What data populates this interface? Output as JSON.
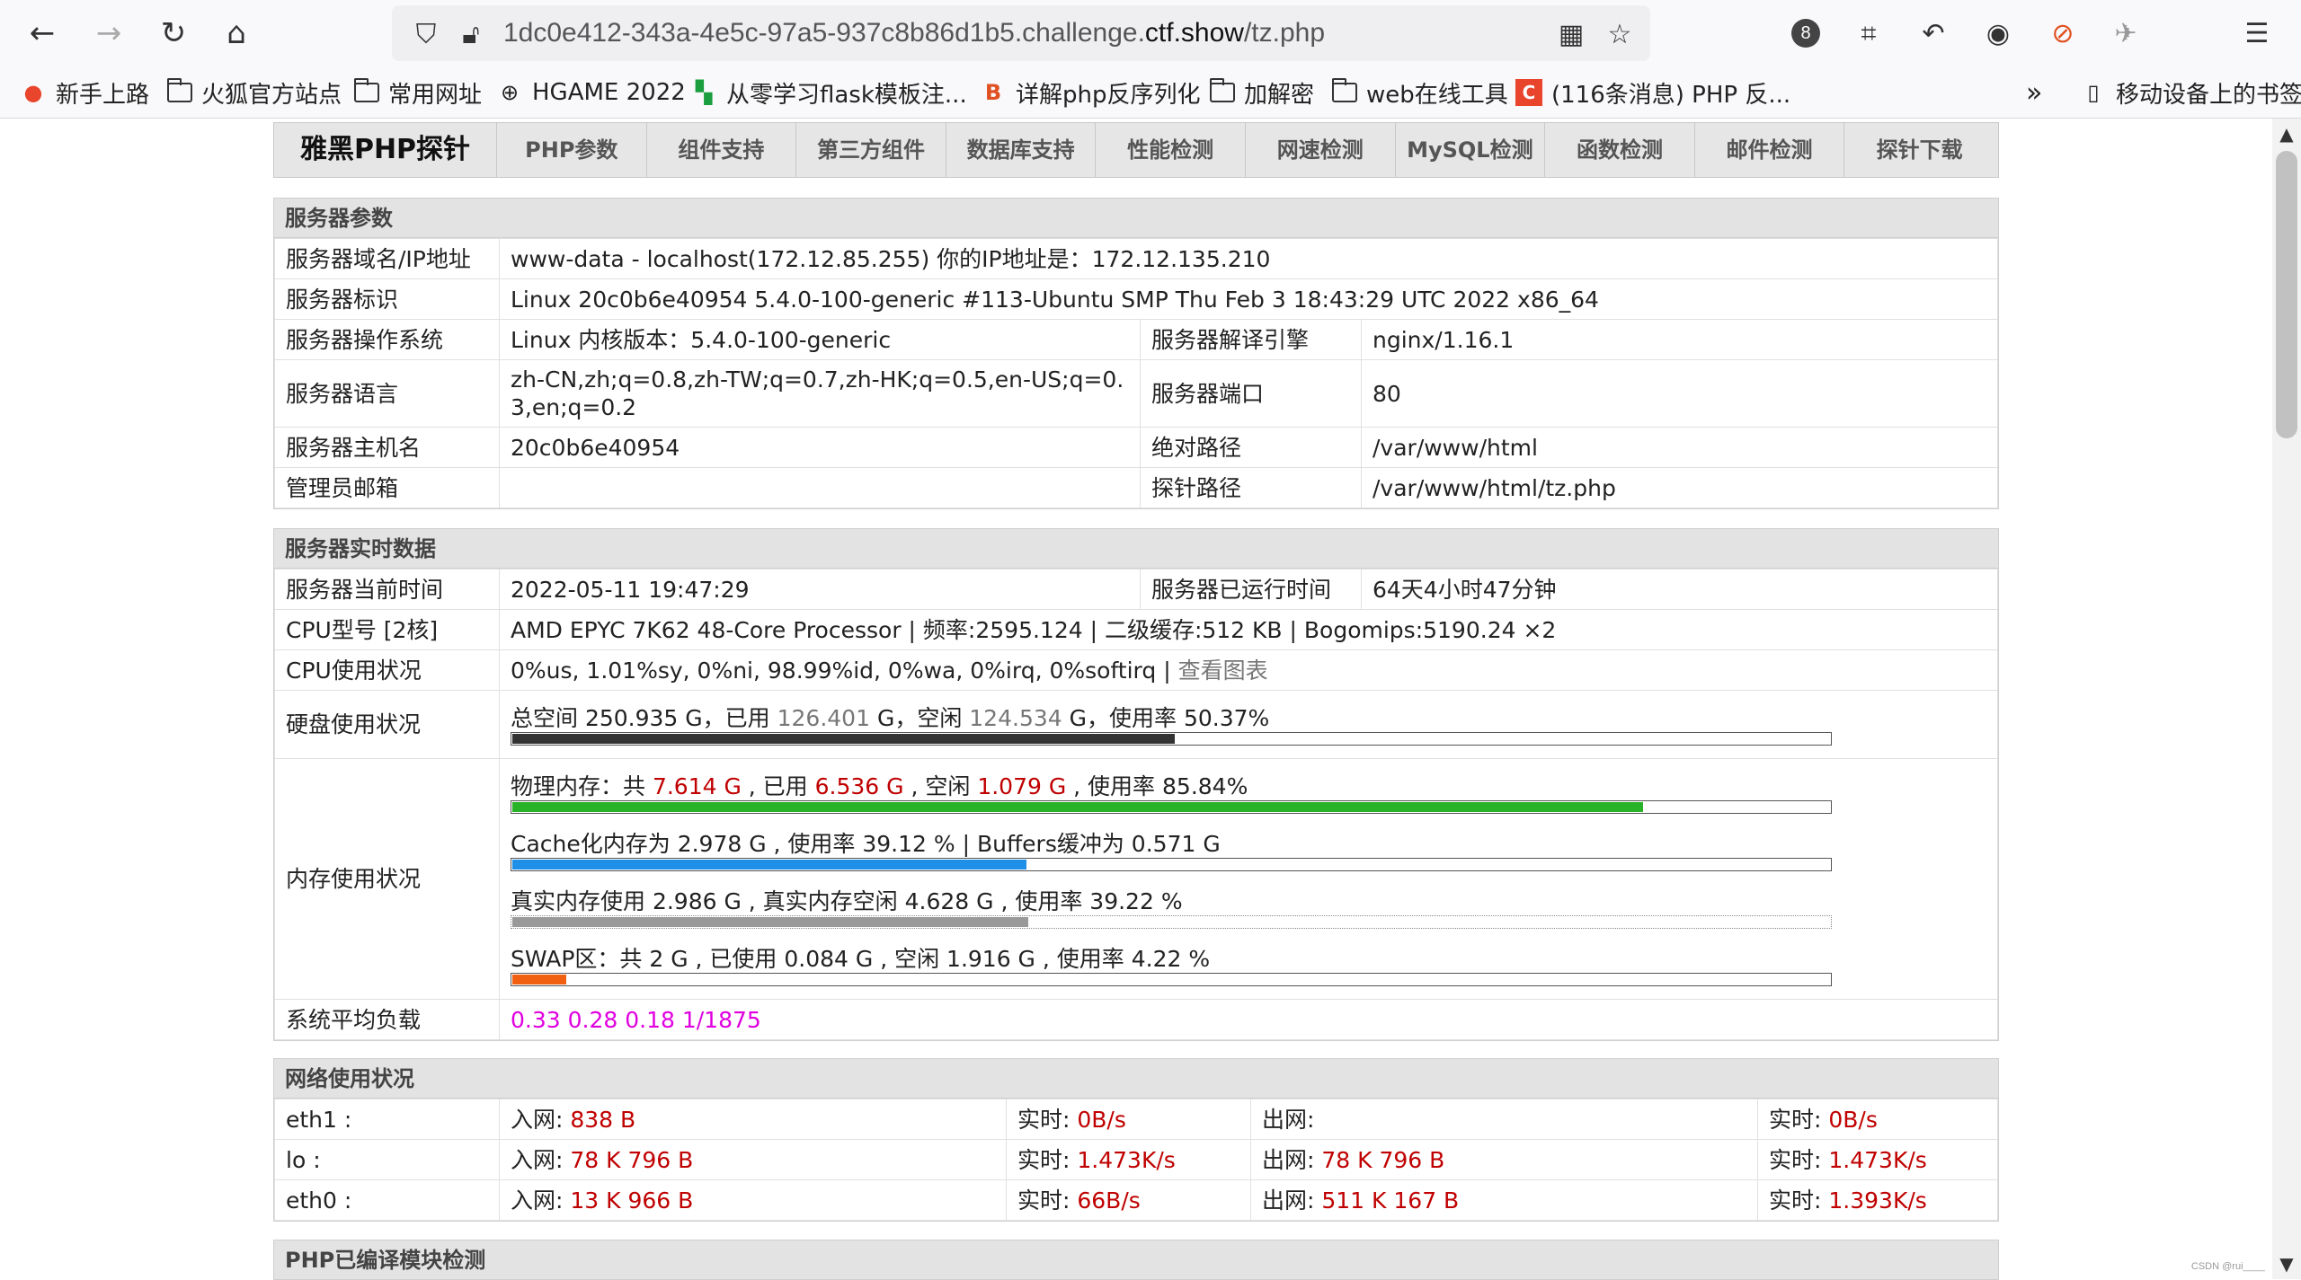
{
  "browser": {
    "url_prefix": "1dc0e412-343a-4e5c-97a5-937c8b86d1b5.challenge.",
    "url_host": "ctf.show",
    "url_path": "/tz.php",
    "extension_badge": "8",
    "bookmarks": [
      {
        "label": "新手上路",
        "icon": "firefox-icon"
      },
      {
        "label": "火狐官方站点",
        "icon": "folder-icon"
      },
      {
        "label": "常用网址",
        "icon": "folder-icon"
      },
      {
        "label": "HGAME 2022",
        "icon": "globe-icon"
      },
      {
        "label": "从零学习flask模板注...",
        "icon": "site-icon"
      },
      {
        "label": "详解php反序列化",
        "icon": "site-icon"
      },
      {
        "label": "加解密",
        "icon": "folder-icon"
      },
      {
        "label": "web在线工具",
        "icon": "folder-icon"
      },
      {
        "label": "(116条消息) PHP 反...",
        "icon": "csdn-icon"
      }
    ],
    "mobile_bookmarks": "移动设备上的书签",
    "overflow": "»"
  },
  "nav": {
    "brand": "雅黑PHP探针",
    "items": [
      "PHP参数",
      "组件支持",
      "第三方组件",
      "数据库支持",
      "性能检测",
      "网速检测",
      "MySQL检测",
      "函数检测",
      "邮件检测",
      "探针下载"
    ]
  },
  "server": {
    "title": "服务器参数",
    "domain_label": "服务器域名/IP地址",
    "domain_value": "www-data - localhost(172.12.85.255)  你的IP地址是：172.12.135.210",
    "id_label": "服务器标识",
    "id_value": "Linux 20c0b6e40954 5.4.0-100-generic #113-Ubuntu SMP Thu Feb 3 18:43:29 UTC 2022 x86_64",
    "os_label": "服务器操作系统",
    "os_value": "Linux  内核版本：5.4.0-100-generic",
    "engine_label": "服务器解译引擎",
    "engine_value": "nginx/1.16.1",
    "lang_label": "服务器语言",
    "lang_value": "zh-CN,zh;q=0.8,zh-TW;q=0.7,zh-HK;q=0.5,en-US;q=0.3,en;q=0.2",
    "port_label": "服务器端口",
    "port_value": "80",
    "host_label": "服务器主机名",
    "host_value": "20c0b6e40954",
    "abspath_label": "绝对路径",
    "abspath_value": "/var/www/html",
    "admin_label": "管理员邮箱",
    "admin_value": "",
    "probe_label": "探针路径",
    "probe_value": "/var/www/html/tz.php"
  },
  "realtime": {
    "title": "服务器实时数据",
    "time_label": "服务器当前时间",
    "time_value": "2022-05-11 19:47:29",
    "uptime_label": "服务器已运行时间",
    "uptime_value": "64天4小时47分钟",
    "cpu_label": "CPU型号 [2核]",
    "cpu_value": "AMD EPYC 7K62 48-Core Processor | 频率:2595.124 | 二级缓存:512 KB | Bogomips:5190.24 ×2",
    "cpuuse_label": "CPU使用状况",
    "cpuuse_value": "0%us, 1.01%sy, 0%ni, 98.99%id, 0%wa, 0%irq, 0%softirq | ",
    "cpuuse_link": "查看图表",
    "disk_label": "硬盘使用状况",
    "disk": {
      "t1": "总空间 250.935 G，已用 ",
      "used": "126.401",
      "t2": " G，空闲 ",
      "free": "124.534",
      "t3": " G，使用率 50.37%",
      "percent": 50.37
    },
    "mem_label": "内存使用状况",
    "mem_physical": {
      "t1": "物理内存：共 ",
      "total": "7.614 G",
      "t2": " , 已用 ",
      "used": "6.536 G",
      "t3": " , 空闲 ",
      "free": "1.079 G",
      "t4": " , 使用率 85.84%",
      "percent": 85.84
    },
    "mem_cache": {
      "text": "Cache化内存为 2.978 G , 使用率 39.12 % | Buffers缓冲为 0.571 G",
      "percent": 39.12
    },
    "mem_real": {
      "text": "真实内存使用 2.986 G , 真实内存空闲 4.628 G , 使用率 39.22 %",
      "percent": 39.22
    },
    "mem_swap": {
      "text": "SWAP区：共 2 G , 已使用 0.084 G , 空闲 1.916 G , 使用率 4.22 %",
      "percent": 4.22
    },
    "load_label": "系统平均负载",
    "load_value": "0.33 0.28 0.18 1/1875"
  },
  "network": {
    "title": "网络使用状况",
    "rows": [
      {
        "iface": "eth1 :",
        "in_label": "入网: ",
        "in": "838 B",
        "rt1_label": "实时: ",
        "rt1": "0B/s",
        "out_label": "出网: ",
        "out": "",
        "rt2_label": "实时: ",
        "rt2": "0B/s"
      },
      {
        "iface": "lo :",
        "in_label": "入网: ",
        "in": "78 K 796 B",
        "rt1_label": "实时: ",
        "rt1": "1.473K/s",
        "out_label": "出网: ",
        "out": "78 K 796 B",
        "rt2_label": "实时: ",
        "rt2": "1.473K/s"
      },
      {
        "iface": "eth0 :",
        "in_label": "入网: ",
        "in": "13 K 966 B",
        "rt1_label": "实时: ",
        "rt1": "66B/s",
        "out_label": "出网: ",
        "out": "511 K 167 B",
        "rt2_label": "实时: ",
        "rt2": "1.393K/s"
      }
    ]
  },
  "php_modules": {
    "title": "PHP已编译模块检测"
  },
  "colors": {
    "mem_physical": "#27b227",
    "mem_cache": "#1e90e8",
    "mem_real": "#999999",
    "mem_swap": "#f06010",
    "disk": "#333333"
  },
  "watermark": "CSDN @rui____"
}
